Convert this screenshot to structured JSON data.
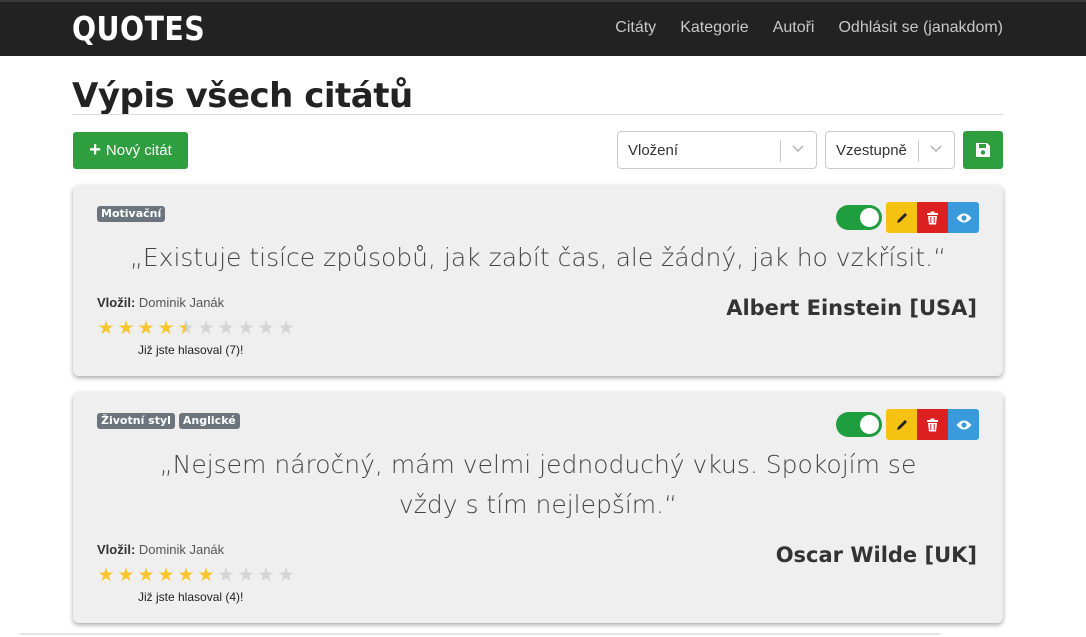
{
  "navbar": {
    "brand": "QUOTES",
    "links": [
      "Citáty",
      "Kategorie",
      "Autoři",
      "Odhlásit se (janakdom)"
    ]
  },
  "page_title": "Výpis všech citátů",
  "toolbar": {
    "new_button_label": "Nový citát",
    "sort_field": "Vložení",
    "sort_order": "Vzestupně",
    "save_icon": "floppy-disk-icon"
  },
  "colors": {
    "navbar": "#222222",
    "green": "#2e9e3e",
    "edit": "#f5c211",
    "delete": "#dc1f1f",
    "view": "#3a9bdc",
    "star": "#f7c62f"
  },
  "quotes": [
    {
      "tags": [
        "Motivační"
      ],
      "text": "„Existuje tisíce způsobů, jak zabít čas, ale žádný, jak ho vzkřísit.“",
      "added_label": "Vložil:",
      "added_by": "Dominik Janák",
      "rating": 4.5,
      "max_rating": 10,
      "voted_text": "Již jste hlasoval (7)!",
      "author": "Albert Einstein [USA]",
      "enabled": true
    },
    {
      "tags": [
        "Životní styl",
        "Anglické"
      ],
      "text": "„Nejsem náročný, mám velmi jednoduchý vkus. Spokojím se vždy s tím nejlepším.“",
      "added_label": "Vložil:",
      "added_by": "Dominik Janák",
      "rating": 6,
      "max_rating": 10,
      "voted_text": "Již jste hlasoval (4)!",
      "author": "Oscar Wilde [UK]",
      "enabled": true
    }
  ]
}
